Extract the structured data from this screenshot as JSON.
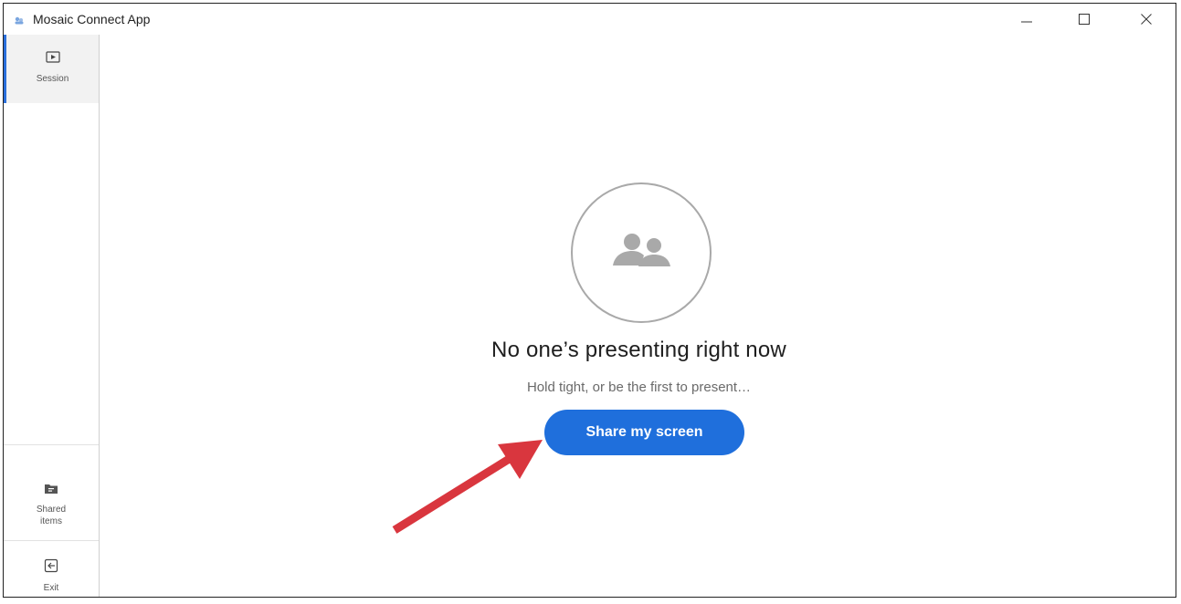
{
  "window": {
    "title": "Mosaic Connect App",
    "controls": {
      "minimize_icon": "minimize-icon",
      "maximize_icon": "maximize-icon",
      "close_icon": "close-icon"
    }
  },
  "sidebar": {
    "items": [
      {
        "label": "Session",
        "icon": "play-screen-icon",
        "active": true
      },
      {
        "label": "Shared items",
        "icon": "folder-icon",
        "active": false
      },
      {
        "label": "Exit",
        "icon": "exit-icon",
        "active": false
      }
    ]
  },
  "main": {
    "empty_state": {
      "icon": "people-icon",
      "headline": "No one’s presenting right now",
      "subtext": "Hold tight, or be the first to present…",
      "share_button_label": "Share my screen"
    }
  },
  "annotation": {
    "icon": "red-arrow-icon"
  },
  "colors": {
    "accent": "#1f6fdc",
    "arrow": "#d9363e",
    "icon_gray": "#a9a9a9"
  }
}
